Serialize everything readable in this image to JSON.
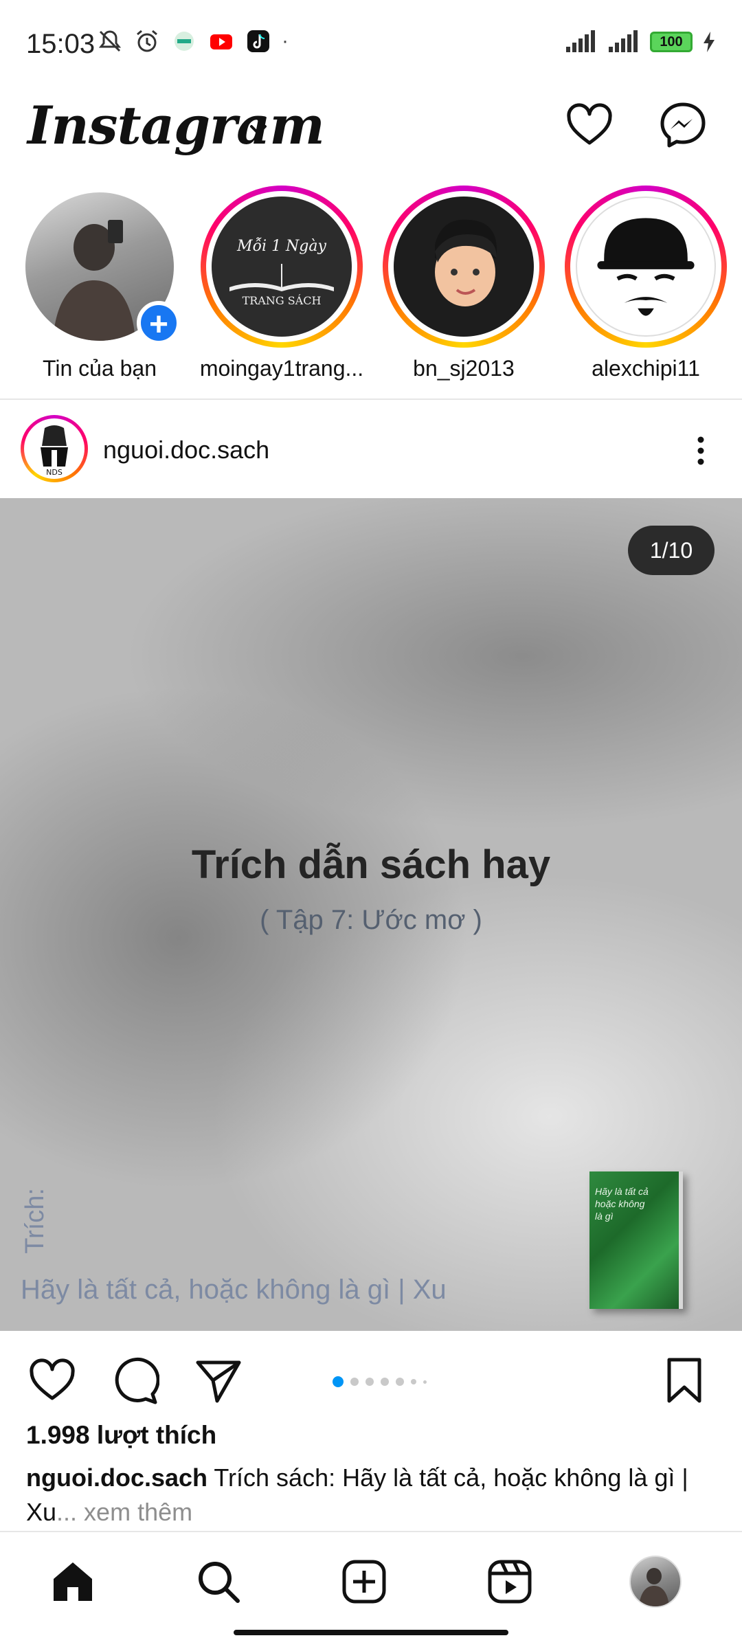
{
  "status_bar": {
    "time": "15:03",
    "battery": "100",
    "icons": [
      "mute-icon",
      "alarm-icon",
      "app-icon",
      "youtube-icon",
      "tiktok-icon",
      "signal-icon",
      "signal-icon",
      "battery-icon",
      "charging-icon"
    ]
  },
  "header": {
    "logo_text": "Instagram",
    "icons": [
      "chevron-down-icon",
      "heart-icon",
      "messenger-icon"
    ]
  },
  "stories": [
    {
      "name": "Tin của bạn",
      "own": true
    },
    {
      "name": "moingay1trang...",
      "avatar_text_top": "Mỗi 1 Ngày",
      "avatar_text_bottom": "TRANG SÁCH"
    },
    {
      "name": "bn_sj2013"
    },
    {
      "name": "alexchipi11"
    }
  ],
  "post": {
    "username": "nguoi.doc.sach",
    "avatar_text": "NDS",
    "counter": "1/10",
    "image_title": "Trích dẫn sách hay",
    "image_subtitle": "( Tập 7: Ước mơ )",
    "image_side_label": "Trích:",
    "image_quote": "Hãy là tất cả, hoặc không là gì | Xu",
    "book_cover_text": "Hãy là tất cả hoặc không là gì",
    "carousel": {
      "current": 1,
      "total": 10
    },
    "likes": "1.998 lượt thích",
    "caption_user": "nguoi.doc.sach",
    "caption_text": "Trích sách: Hãy là tất cả, hoặc không là gì | Xu",
    "caption_more": "... xem thêm"
  },
  "bottom_nav": [
    "home-icon",
    "search-icon",
    "create-icon",
    "reels-icon",
    "profile-avatar"
  ],
  "colors": {
    "accent_blue": "#0095f6",
    "story_gradient": [
      "#d300c5",
      "#ff0169",
      "#ff7a00",
      "#ffd600"
    ],
    "add_badge": "#1877f2"
  }
}
